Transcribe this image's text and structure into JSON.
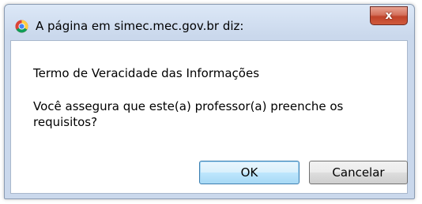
{
  "dialog": {
    "title": "A página em simec.mec.gov.br diz:",
    "close_label": "x",
    "heading": "Termo de Veracidade das Informações",
    "message": "Você assegura que este(a) professor(a) preenche os requisitos?",
    "ok_label": "OK",
    "cancel_label": "Cancelar",
    "title_icon": "chrome-icon"
  }
}
